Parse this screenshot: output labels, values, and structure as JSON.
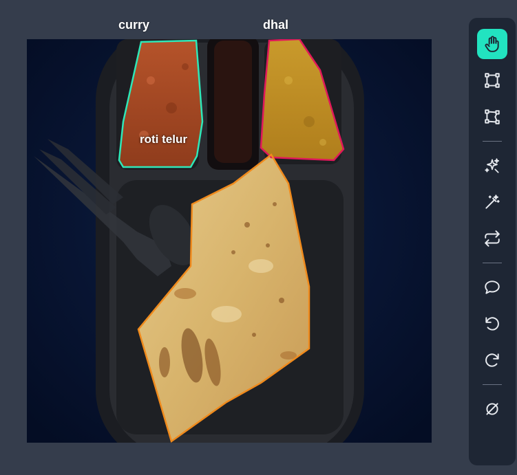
{
  "labels": {
    "curry": "curry",
    "dhal": "dhal",
    "roti_telur": "roti telur"
  },
  "colors": {
    "background": "#353d4c",
    "toolbar": "#1e2634",
    "active_tool": "#22e3c0",
    "curry_outline": "#2ee8b8",
    "dhal_outline": "#e0185a",
    "roti_outline": "#f08a1c"
  },
  "toolbar": {
    "tools": [
      {
        "icon": "hand-pan-icon",
        "active": true
      },
      {
        "icon": "bounding-box-icon",
        "active": false
      },
      {
        "icon": "polygon-icon",
        "active": false
      },
      {
        "icon": "magic-sparkle-icon",
        "active": false
      },
      {
        "icon": "magic-wand-icon",
        "active": false
      },
      {
        "icon": "swap-icon",
        "active": false
      },
      {
        "icon": "comment-icon",
        "active": false
      },
      {
        "icon": "undo-icon",
        "active": false
      },
      {
        "icon": "redo-icon",
        "active": false
      },
      {
        "icon": "clear-icon",
        "active": false
      }
    ]
  }
}
